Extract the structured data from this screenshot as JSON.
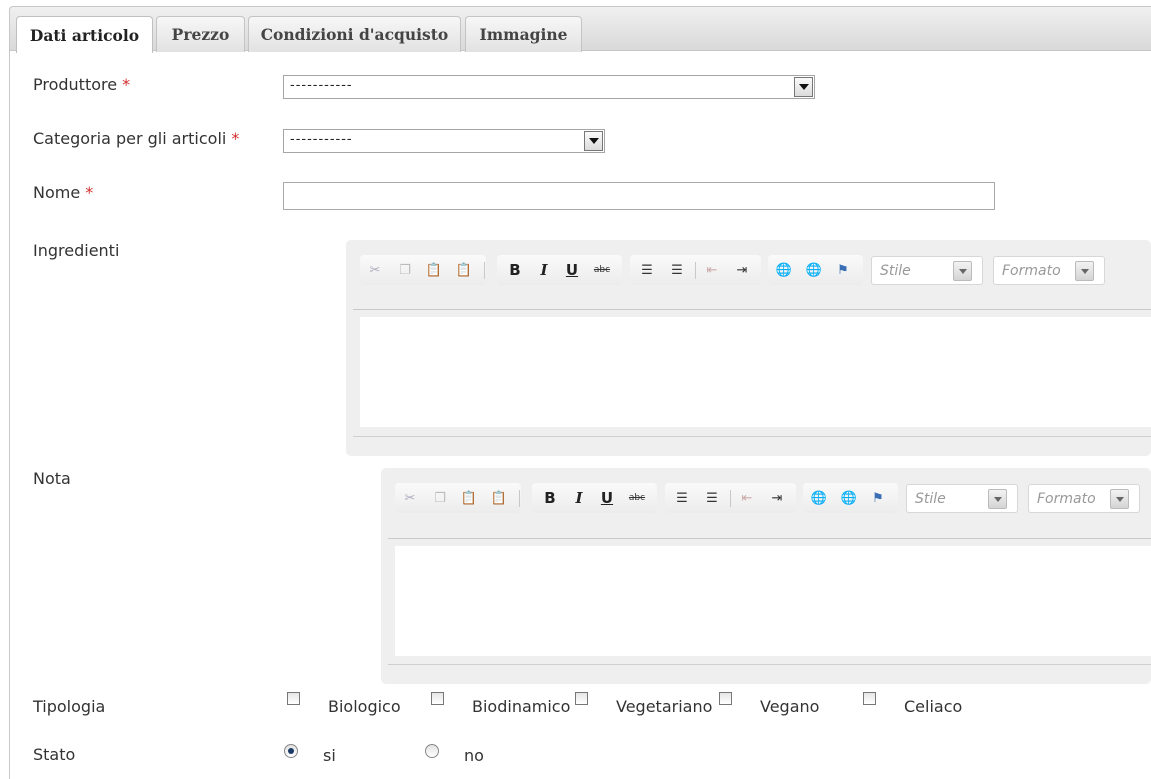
{
  "tabs": [
    {
      "label": "Dati articolo",
      "active": true
    },
    {
      "label": "Prezzo",
      "active": false
    },
    {
      "label": "Condizioni d'acquisto",
      "active": false
    },
    {
      "label": "Immagine",
      "active": false
    }
  ],
  "form": {
    "required_mark": "*",
    "produttore": {
      "label": "Produttore",
      "value": "-----------"
    },
    "categoria": {
      "label": "Categoria per gli articoli",
      "value": "-----------"
    },
    "nome": {
      "label": "Nome",
      "value": ""
    },
    "ingredienti": {
      "label": "Ingredienti"
    },
    "nota": {
      "label": "Nota"
    },
    "tipologia": {
      "label": "Tipologia",
      "options": [
        {
          "label": "Biologico",
          "checked": false
        },
        {
          "label": "Biodinamico",
          "checked": false
        },
        {
          "label": "Vegetariano",
          "checked": false
        },
        {
          "label": "Vegano",
          "checked": false
        },
        {
          "label": "Celiaco",
          "checked": false
        }
      ]
    },
    "stato": {
      "label": "Stato",
      "options": [
        {
          "label": "si",
          "selected": true
        },
        {
          "label": "no",
          "selected": false
        }
      ]
    }
  },
  "editor": {
    "bold": "B",
    "italic": "I",
    "underline": "U",
    "strike": "abc",
    "style_placeholder": "Stile",
    "format_placeholder": "Formato",
    "icons": [
      "cut-icon",
      "copy-icon",
      "paste-icon",
      "paste-word-icon",
      "bold-icon",
      "italic-icon",
      "underline-icon",
      "strikethrough-icon",
      "numbered-list-icon",
      "bulleted-list-icon",
      "outdent-icon",
      "indent-icon",
      "link-icon",
      "unlink-icon",
      "anchor-flag-icon"
    ]
  },
  "colors": {
    "required": "#d32f2f",
    "radio_dot": "#1b3b66",
    "tab_bar": "#dcdcdc"
  }
}
